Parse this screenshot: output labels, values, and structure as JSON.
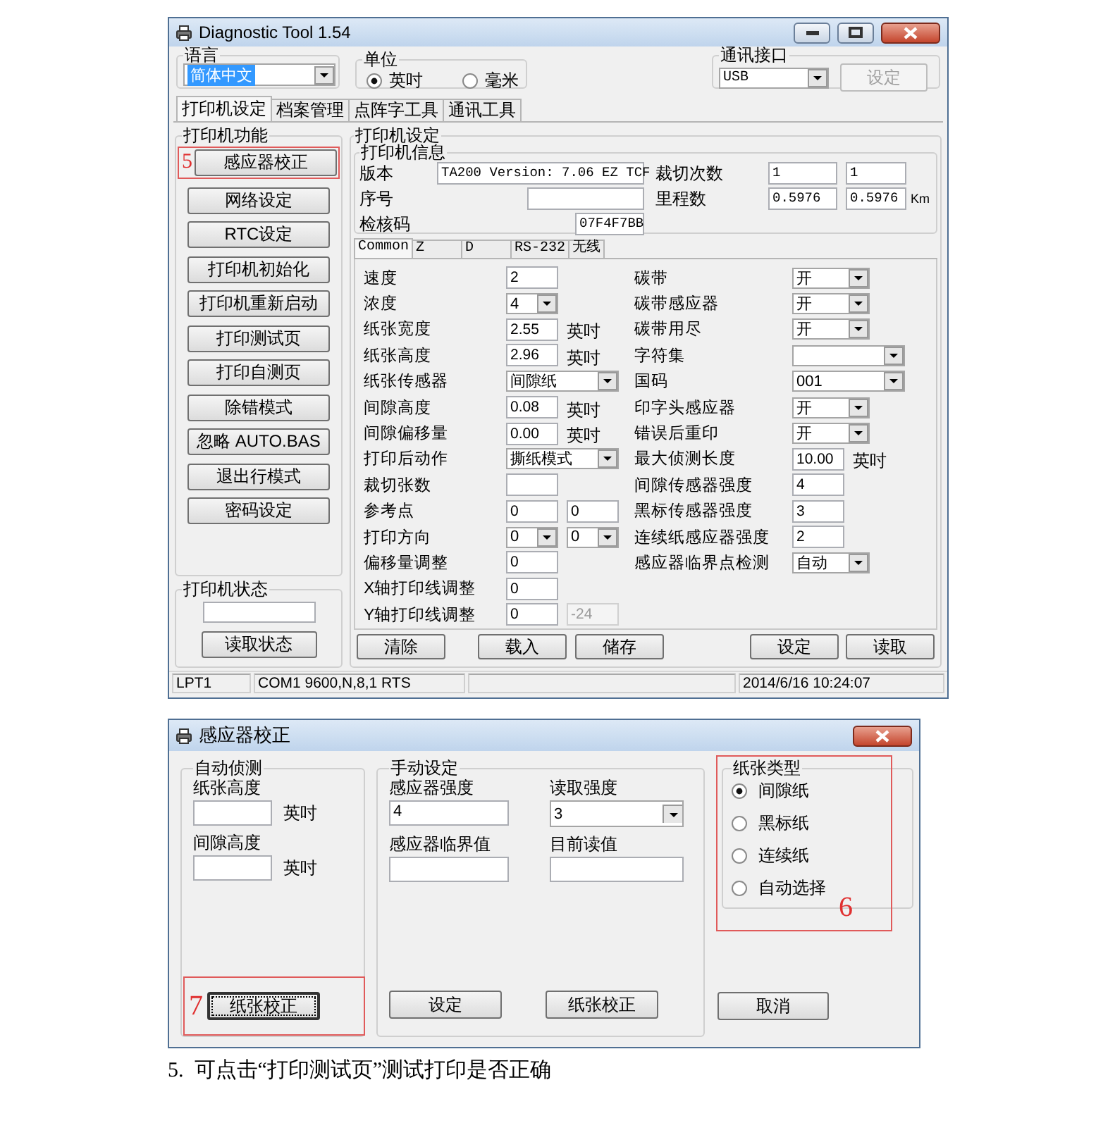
{
  "main_window": {
    "title": "Diagnostic Tool 1.54",
    "language": {
      "label": "语言",
      "value": "简体中文"
    },
    "unit": {
      "label": "单位",
      "options": [
        {
          "label": "英吋",
          "selected": true
        },
        {
          "label": "毫米",
          "selected": false
        }
      ]
    },
    "port": {
      "label": "通讯接口",
      "value": "USB",
      "button": {
        "label": "设定",
        "disabled": true
      }
    },
    "tabs": [
      {
        "label": "打印机设定",
        "selected": true
      },
      {
        "label": "档案管理",
        "selected": false
      },
      {
        "label": "点阵字工具",
        "selected": false
      },
      {
        "label": "通讯工具",
        "selected": false
      }
    ],
    "functions": {
      "label": "打印机功能",
      "buttons": [
        {
          "label": "感应器校正",
          "annotation": "5"
        },
        {
          "label": "网络设定"
        },
        {
          "label": "RTC设定"
        },
        {
          "label": "打印机初始化"
        },
        {
          "label": "打印机重新启动"
        },
        {
          "label": "打印测试页"
        },
        {
          "label": "打印自测页"
        },
        {
          "label": "除错模式"
        },
        {
          "label": "忽略 AUTO.BAS"
        },
        {
          "label": "退出行模式"
        },
        {
          "label": "密码设定"
        }
      ]
    },
    "status": {
      "label": "打印机状态",
      "button": "读取状态"
    },
    "settings": {
      "label": "打印机设定",
      "info": {
        "label": "打印机信息",
        "rows": [
          {
            "label": "版本",
            "value": "TA200 Version: 7.06 EZ TCF",
            "label2": "裁切次数",
            "values2": [
              "1",
              "1"
            ]
          },
          {
            "label": "序号",
            "label2": "里程数",
            "values2": [
              "0.5976",
              "0.5976"
            ],
            "unit": "Km"
          },
          {
            "label": "检核码",
            "value": "07F4F7BB"
          }
        ]
      },
      "tabs": [
        {
          "label": "Common",
          "selected": true
        },
        {
          "label": "Z",
          "selected": false
        },
        {
          "label": "D",
          "selected": false
        },
        {
          "label": "RS-232",
          "selected": false
        },
        {
          "label": "无线",
          "selected": false
        }
      ],
      "left": [
        {
          "label": "速度",
          "controls": [
            {
              "kind": "input",
              "value": "2"
            }
          ]
        },
        {
          "label": "浓度",
          "controls": [
            {
              "kind": "select",
              "value": "4"
            }
          ]
        },
        {
          "label": "纸张宽度",
          "controls": [
            {
              "kind": "input",
              "value": "2.55"
            }
          ],
          "unit": "英吋"
        },
        {
          "label": "纸张高度",
          "controls": [
            {
              "kind": "input",
              "value": "2.96"
            }
          ],
          "unit": "英吋"
        },
        {
          "label": "纸张传感器",
          "controls": [
            {
              "kind": "wide-select",
              "value": "间隙纸"
            }
          ]
        },
        {
          "label": "间隙高度",
          "controls": [
            {
              "kind": "input",
              "value": "0.08"
            }
          ],
          "unit": "英吋"
        },
        {
          "label": "间隙偏移量",
          "controls": [
            {
              "kind": "input",
              "value": "0.00"
            }
          ],
          "unit": "英吋"
        },
        {
          "label": "打印后动作",
          "controls": [
            {
              "kind": "wide-select",
              "value": "撕纸模式"
            }
          ]
        },
        {
          "label": "裁切张数",
          "controls": [
            {
              "kind": "input"
            }
          ]
        },
        {
          "label": "参考点",
          "controls": [
            {
              "kind": "input",
              "value": "0"
            },
            {
              "kind": "input",
              "value": "0"
            }
          ]
        },
        {
          "label": "打印方向",
          "controls": [
            {
              "kind": "select",
              "value": "0"
            },
            {
              "kind": "select",
              "value": "0"
            }
          ]
        },
        {
          "label": "偏移量调整",
          "controls": [
            {
              "kind": "input",
              "value": "0"
            }
          ]
        },
        {
          "label": "X轴打印线调整",
          "controls": [
            {
              "kind": "input",
              "value": "0"
            }
          ]
        },
        {
          "label": "Y轴打印线调整",
          "controls": [
            {
              "kind": "input",
              "value": "0",
              "disabled": false
            },
            {
              "kind": "input",
              "value": "-24",
              "disabled": true
            }
          ]
        }
      ],
      "right": [
        {
          "label": "碳带",
          "controls": [
            {
              "kind": "select",
              "value": "开"
            }
          ]
        },
        {
          "label": "碳带感应器",
          "controls": [
            {
              "kind": "select",
              "value": "开"
            }
          ]
        },
        {
          "label": "碳带用尽",
          "controls": [
            {
              "kind": "select",
              "value": "开"
            }
          ]
        },
        {
          "label": "字符集",
          "controls": [
            {
              "kind": "wide-select"
            }
          ]
        },
        {
          "label": "国码",
          "controls": [
            {
              "kind": "wide-select",
              "value": "001"
            }
          ]
        },
        {
          "label": "印字头感应器",
          "controls": [
            {
              "kind": "select",
              "value": "开"
            }
          ]
        },
        {
          "label": "错误后重印",
          "controls": [
            {
              "kind": "select",
              "value": "开"
            }
          ]
        },
        {
          "label": "最大侦测长度",
          "controls": [
            {
              "kind": "input",
              "value": "10.00"
            }
          ],
          "unit": "英吋"
        },
        {
          "label": "间隙传感器强度",
          "controls": [
            {
              "kind": "input",
              "value": "4"
            }
          ]
        },
        {
          "label": "黑标传感器强度",
          "controls": [
            {
              "kind": "input",
              "value": "3"
            }
          ]
        },
        {
          "label": "连续纸感应器强度",
          "controls": [
            {
              "kind": "input",
              "value": "2"
            }
          ]
        },
        {
          "label": "感应器临界点检测",
          "controls": [
            {
              "kind": "select",
              "value": "自动"
            }
          ]
        }
      ],
      "buttons": [
        "清除",
        "载入",
        "储存",
        "设定",
        "读取"
      ]
    },
    "status_bar": [
      "LPT1",
      "COM1 9600,N,8,1 RTS",
      "2014/6/16 10:24:07"
    ]
  },
  "calibration_window": {
    "title": "感应器校正",
    "auto": {
      "label": "自动侦测",
      "fields": [
        {
          "label": "纸张高度",
          "unit": "英吋"
        },
        {
          "label": "间隙高度",
          "unit": "英吋"
        }
      ],
      "button": {
        "label": "纸张校正",
        "focused": true,
        "annotation": "7"
      }
    },
    "manual": {
      "label": "手动设定",
      "fields": [
        {
          "label": "感应器强度",
          "kind": "input",
          "value": "4"
        },
        {
          "label": "读取强度",
          "kind": "select",
          "value": "3"
        },
        {
          "label": "感应器临界值",
          "kind": "input"
        },
        {
          "label": "目前读值",
          "kind": "input"
        }
      ],
      "buttons": [
        {
          "label": "设定",
          "focused": false
        },
        {
          "label": "纸张校正",
          "focused": false
        }
      ]
    },
    "paper_type": {
      "label": "纸张类型",
      "annotation": "6",
      "options": [
        {
          "label": "间隙纸",
          "selected": true
        },
        {
          "label": "黑标纸",
          "selected": false
        },
        {
          "label": "连续纸",
          "selected": false
        },
        {
          "label": "自动选择",
          "selected": false
        }
      ]
    },
    "cancel": {
      "label": "取消",
      "focused": false
    }
  },
  "caption": "5.  可点击“打印测试页”测试打印是否正确"
}
